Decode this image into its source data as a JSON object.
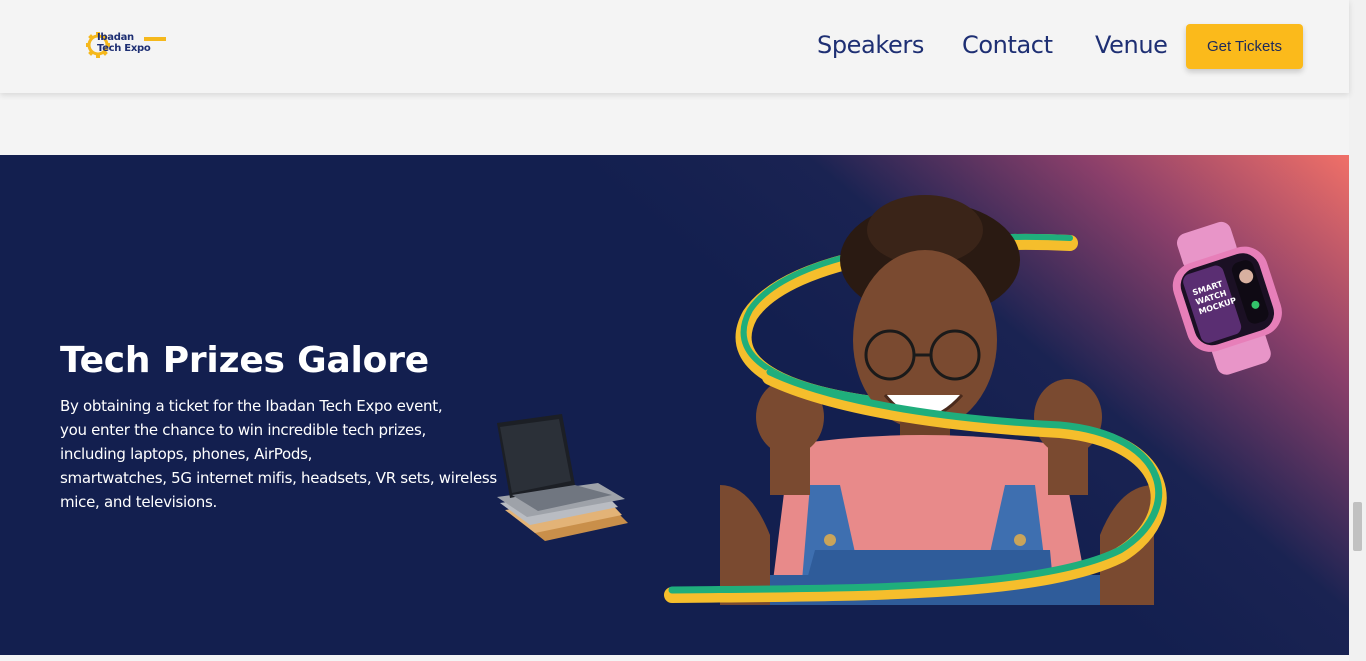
{
  "header": {
    "logo": {
      "line1": "Ibadan",
      "line2": "Tech Expo"
    },
    "nav": [
      "Speakers",
      "Contact",
      "Venue"
    ],
    "cta_label": "Get Tickets"
  },
  "hero": {
    "title": "Tech Prizes Galore",
    "description_lines": [
      "By obtaining a ticket for the Ibadan Tech Expo event,",
      "you enter the chance to win incredible tech prizes,",
      "including laptops, phones, AirPods,",
      "smartwatches, 5G internet mifis, headsets, VR sets, wireless",
      "mice, and televisions."
    ],
    "watch_screen_text": [
      "SMART",
      "WATCH",
      "MOCKUP"
    ]
  },
  "colors": {
    "navy": "#131f4f",
    "brand_blue": "#1e2f73",
    "accent_yellow": "#fbba1b",
    "ribbon_green": "#1fae7c",
    "gradient_pink": "#f07068"
  }
}
